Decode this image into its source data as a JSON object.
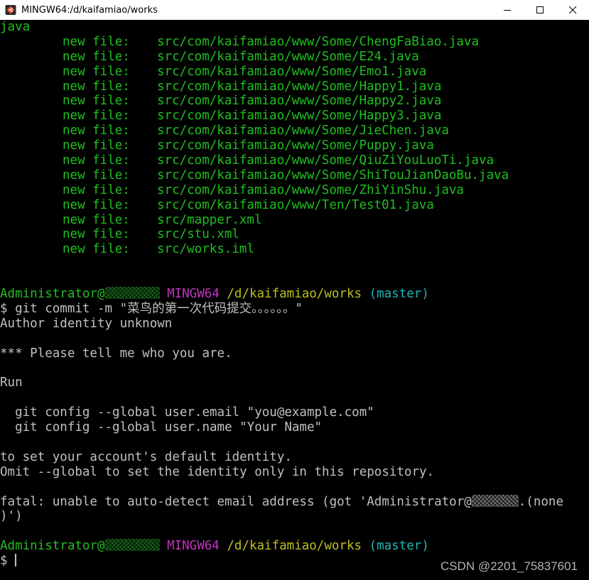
{
  "window": {
    "title": "MINGW64:/d/kaifamiao/works",
    "controls": {
      "minimize": "minimize-icon",
      "maximize": "maximize-icon",
      "close": "close-icon"
    }
  },
  "colors": {
    "background": "#000000",
    "staged_file": "#1fbf1f",
    "prompt_user": "#25bc24",
    "prompt_system": "#c133c1",
    "prompt_path": "#bfbf1f",
    "prompt_branch": "#21b5b5",
    "text": "#c0c0c0"
  },
  "terminal": {
    "top_fragment": "java",
    "file_label": "new file:",
    "new_files": [
      "src/com/kaifamiao/www/Some/ChengFaBiao.java",
      "src/com/kaifamiao/www/Some/E24.java",
      "src/com/kaifamiao/www/Some/Emo1.java",
      "src/com/kaifamiao/www/Some/Happy1.java",
      "src/com/kaifamiao/www/Some/Happy2.java",
      "src/com/kaifamiao/www/Some/Happy3.java",
      "src/com/kaifamiao/www/Some/JieChen.java",
      "src/com/kaifamiao/www/Some/Puppy.java",
      "src/com/kaifamiao/www/Some/QiuZiYouLuoTi.java",
      "src/com/kaifamiao/www/Some/ShiTouJianDaoBu.java",
      "src/com/kaifamiao/www/Some/ZhiYinShu.java",
      "src/com/kaifamiao/www/Ten/Test01.java",
      "src/mapper.xml",
      "src/stu.xml",
      "src/works.iml"
    ],
    "prompt": {
      "user": "Administrator@",
      "system": "MINGW64",
      "path": "/d/kaifamiao/works",
      "branch": "(master)",
      "symbol": "$"
    },
    "command": "git commit -m \"菜鸟的第一次代码提交。。。。。。\"",
    "output": {
      "line1": "Author identity unknown",
      "line2": "*** Please tell me who you are.",
      "line3": "Run",
      "line4": "  git config --global user.email \"you@example.com\"",
      "line5": "  git config --global user.name \"Your Name\"",
      "line6": "to set your account's default identity.",
      "line7": "Omit --global to set the identity only in this repository.",
      "line8a": "fatal: unable to auto-detect email address (got 'Administrator@",
      "line8b": ".(none",
      "line9": ")')"
    }
  },
  "watermark": "CSDN @2201_75837601"
}
